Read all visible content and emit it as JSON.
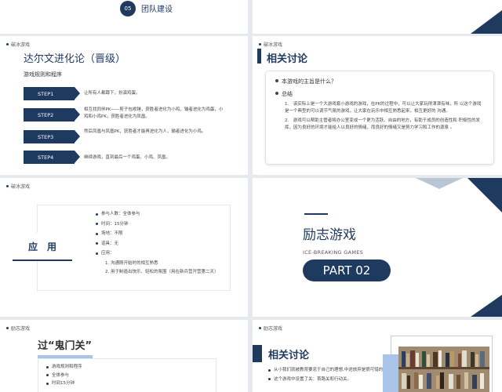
{
  "slide1": {
    "number": "05",
    "title": "团队建设"
  },
  "slide2": {
    "tag": "破冰游戏",
    "title": "达尔文进化论（晋级）",
    "subtitle": "游戏规则和程序",
    "steps": [
      {
        "label": "STEP1",
        "desc": "让所有人都蹲下，扮演鸡蛋。"
      },
      {
        "label": "STEP2",
        "desc": "相互找同伴PK——剪子包袱锤，获胜者进化为小鸡，输者进化为鸡蛋，小鸡和小鸡PK，获胜者进化为凤凰。"
      },
      {
        "label": "STEP3",
        "desc": "然后凤凰与凤凰PK，获胜者才能再进化为人，输者进化为小鸡。"
      },
      {
        "label": "STEP4",
        "desc": "继续游戏，直到最后一个鸡蛋、小鸡、凤凰。"
      }
    ]
  },
  "slide3": {
    "tag": "破冰游戏",
    "title": "相关讨论",
    "q1": "本游戏的主旨是什么？",
    "q2": "总结",
    "points": [
      "1.　该实际上是一个大游戏套小游戏的游戏，在PK的过程中，可以让大家玩得津津有味，所 以这个游戏是一个典型的可以调节气氛的游戏，让大家在玩乐中相互熟悉起来，相互更好的 沟通。",
      "2.　游戏可以帮助主管者将办公室变成一个更为活跃、自由的地方，有助于成员的创造性和 积极性的发挥，因为良好的环境才能给人以良好的情绪，而良好的情绪又是努力学习和工作的源泉 。"
    ]
  },
  "slide4": {
    "tag": "破冰游戏",
    "heading": "应　用",
    "items": [
      "参与人数：全体参与",
      "时间：15分钟",
      "场地：不限",
      "道具：无",
      "应用："
    ],
    "sub": [
      "1.  沟通刚开始时的相互熟悉",
      "2.  用于制造出快乐、轻松的氛围（用在新兵营开营第二天）"
    ]
  },
  "slide5": {
    "title": "励志游戏",
    "subtitle": "ICE-BREAKING GAMES",
    "part": "PART 02"
  },
  "slide6": {
    "tag": "励志游戏",
    "title": "过“鬼门关”",
    "items": [
      "游戏规则和程序",
      "全体参与",
      "时间15分钟"
    ]
  },
  "slide7": {
    "tag": "励志游戏",
    "title": "相关讨论",
    "items": [
      "从小我们就被教育要忠于自己的理想,中途放弃是很可惜的。",
      "这个游戏中设置了关：首路关和行动关。"
    ]
  },
  "colors": {
    "navy": "#1f3a5f",
    "light_blue": "#a9c4e6",
    "bg": "#e6e9ee"
  }
}
